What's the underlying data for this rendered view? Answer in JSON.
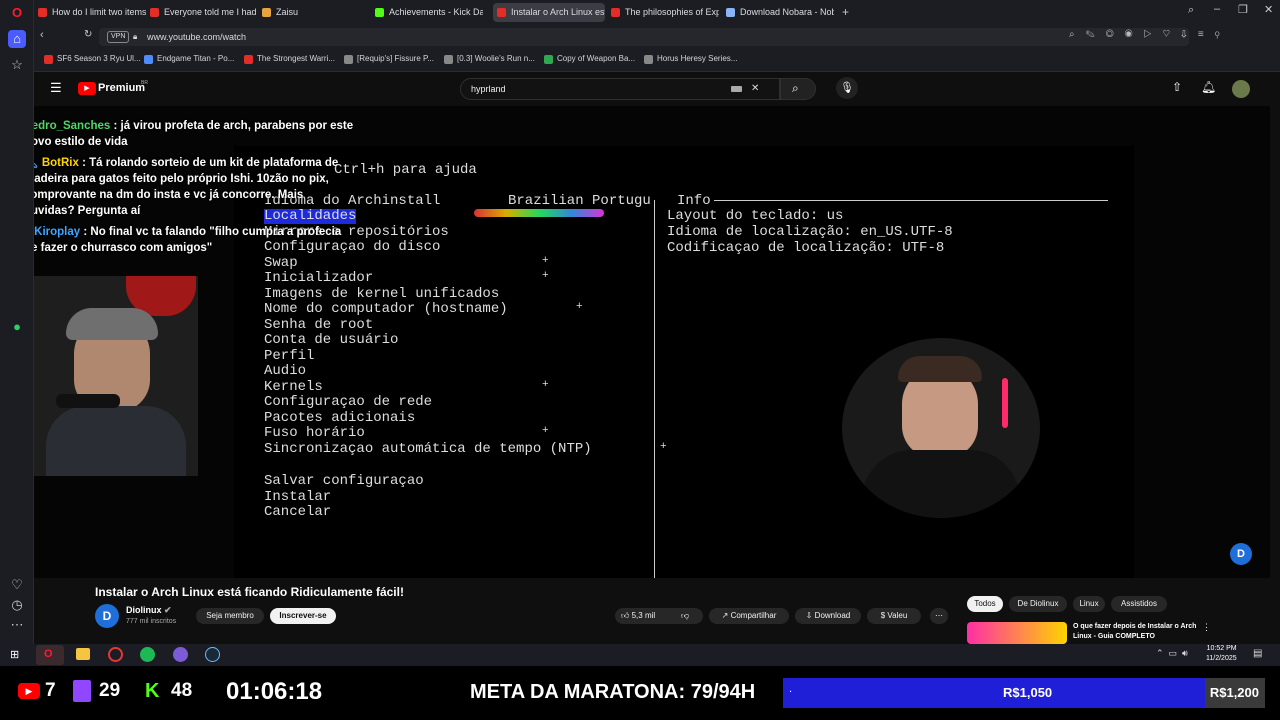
{
  "tabs": [
    {
      "title": "How do I limit two items i",
      "color": "#e52d27"
    },
    {
      "title": "Everyone told me I had to",
      "color": "#e52d27"
    },
    {
      "title": "Zaisu",
      "color": "#e8a33c"
    },
    {
      "title": "Achievements - Kick Dash",
      "color": "#53fc18"
    },
    {
      "title": "Instalar o Arch Linux está",
      "color": "#e52d27",
      "active": true
    },
    {
      "title": "The philosophies of Expe",
      "color": "#e52d27"
    },
    {
      "title": "Download Nobara - Noba",
      "color": "#8ab4f8"
    }
  ],
  "address": {
    "vpn": "VPN",
    "url": "www.youtube.com/watch"
  },
  "bookmarks": [
    {
      "label": "SF6 Season 3 Ryu Ul...",
      "color": "#e52d27"
    },
    {
      "label": "Endgame Titan - Po...",
      "color": "#4e8cff"
    },
    {
      "label": "The Strongest Warri...",
      "color": "#e52d27"
    },
    {
      "label": "[Requip's] Fissure P...",
      "color": "#888888"
    },
    {
      "label": "[0.3] Woolie's Run n...",
      "color": "#888888"
    },
    {
      "label": "Copy of Weapon Ba...",
      "color": "#2fa84f"
    },
    {
      "label": "Horus Heresy Series...",
      "color": "#888888"
    }
  ],
  "youtube": {
    "brand": "Premium",
    "region": "BR",
    "search": "hyprland"
  },
  "video": {
    "terminal_header": "Ctrl+h para ajuda",
    "menu_title": "Idioma do Archinstall",
    "menu_value": "Brazilian Portugu",
    "info_title": "Info",
    "menu_items": [
      "Localidades",
      "Mirrors e repositórios",
      "Configuraçao do disco",
      "Swap",
      "Inicializador",
      "Imagens de kernel unificados",
      "Nome do computador (hostname)",
      "Senha de root",
      "Conta de usuário",
      "Perfil",
      "Audio",
      "Kernels",
      "Configuraçao de rede",
      "Pacotes adicionais",
      "Fuso horário",
      "Sincronizaçao automática de tempo (NTP)"
    ],
    "actions": [
      "Salvar configuraçao",
      "Instalar",
      "Cancelar"
    ],
    "info_lines": [
      "Layout do teclado: us",
      "Idioma de localização: en_US.UTF-8",
      "Codificaçao de localização: UTF-8"
    ],
    "chat": [
      {
        "user": "Pedro_Sanches",
        "color": "#4cd964",
        "text": ": já virou profeta de arch, parabens por este novo estilo de vida"
      },
      {
        "user": "BotRix",
        "color": "#ffd400",
        "text": ": Tá rolando sorteio de um kit de plataforma de madeira para gatos feito pelo próprio Ishi. 10zão no pix, comprovante na dm do insta e vc já concorre. Mais duvidas? Pergunta aí"
      },
      {
        "user": "Kiroplay",
        "color": "#3ea6ff",
        "text": ": No final vc ta falando \"filho cumpra a profecia de fazer o churrasco com amigos\""
      }
    ]
  },
  "below": {
    "title": "Instalar o Arch Linux está ficando Ridiculamente fácil!",
    "channel": "Diolinux",
    "subs": "777 mil inscritos",
    "member": "Seja membro",
    "subscribe": "Inscrever-se",
    "likes": "5,3 mil",
    "share": "Compartilhar",
    "download": "Download",
    "thanks": "Valeu",
    "chips": [
      "Todos",
      "De Diolinux",
      "Linux",
      "Assistidos"
    ],
    "next_title": "O que fazer depois de Instalar o Arch Linux - Guia COMPLETO"
  },
  "taskbar": {
    "time": "10:52 PM",
    "date": "11/2/2025"
  },
  "overlay": {
    "youtube_count": "7",
    "twitch_count": "29",
    "kick_count": "48",
    "timer": "01:06:18",
    "goal_label": "META DA MARATONA: 79/94H",
    "progress_dot": ".",
    "progress_current": "R$1,050",
    "progress_target": "R$1,200",
    "progress_fraction": 0.875
  },
  "colors": {
    "progress_fill": "#1f1fd8",
    "youtube_red": "#ff0000",
    "twitch_purple": "#9146ff",
    "kick_green": "#53fc18"
  }
}
